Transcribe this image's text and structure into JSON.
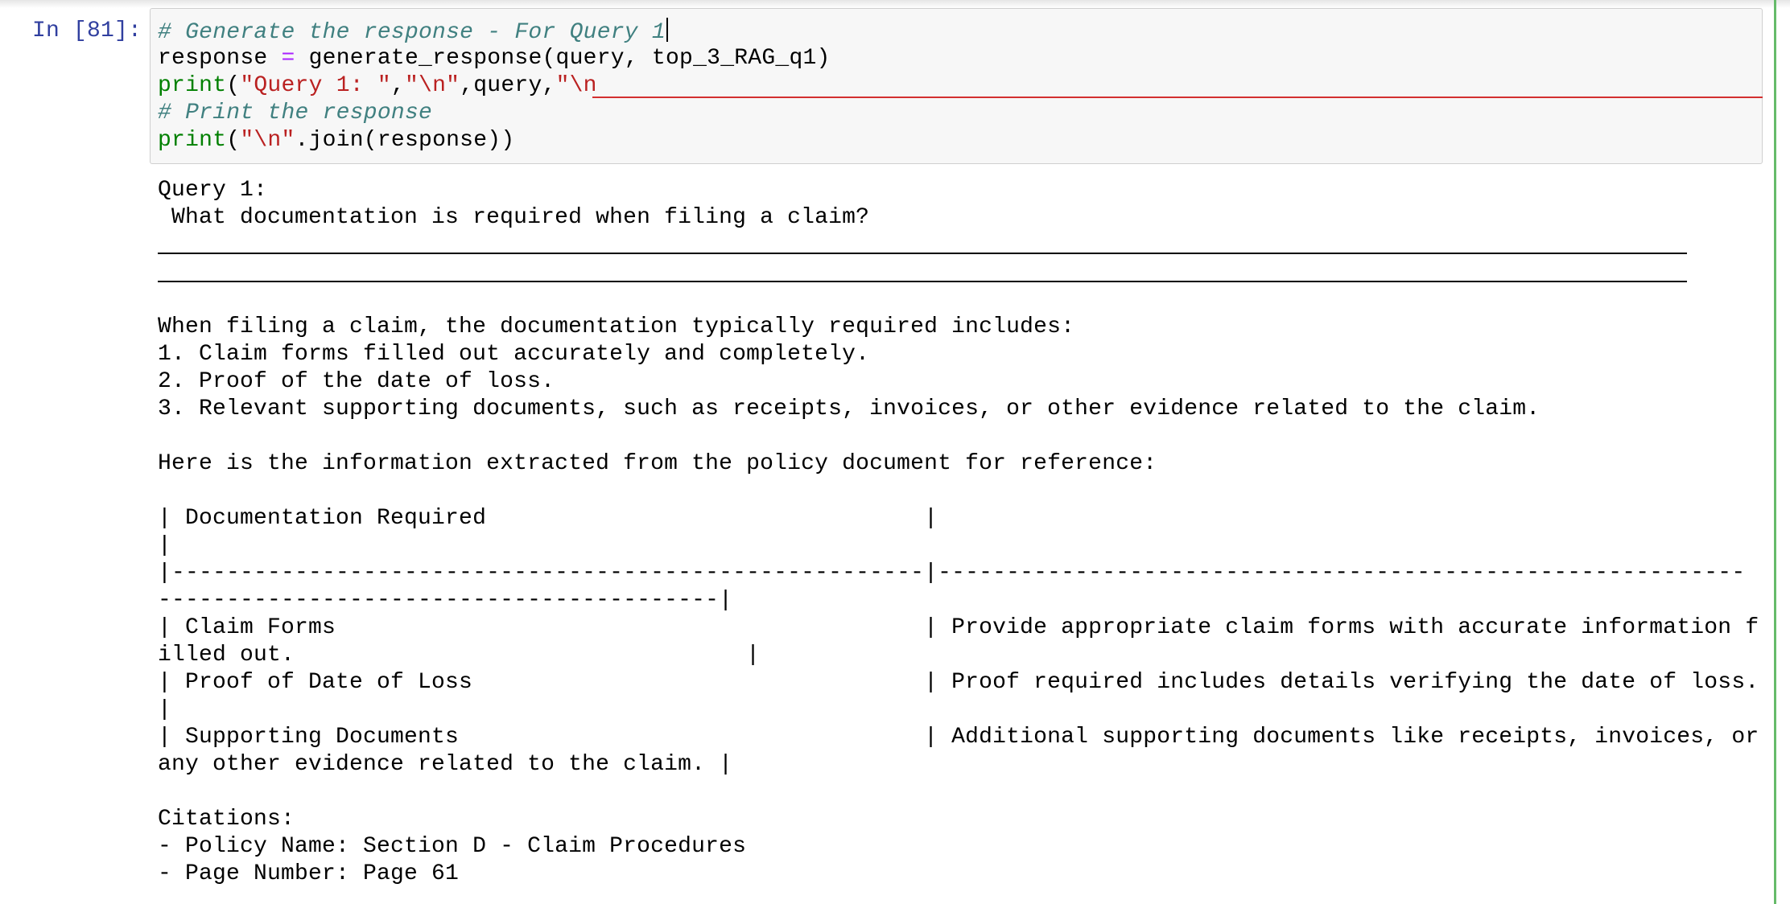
{
  "cell": {
    "prompt": "In [81]:",
    "code": {
      "line1_comment": "# Generate the response - For Query 1",
      "line2": {
        "var": "response",
        "op": "=",
        "rest": "generate_response(query, top_3_RAG_q1)"
      },
      "line3": {
        "kw": "print",
        "p1": "(",
        "s1": "\"Query 1: \"",
        "c1": ",",
        "s2": "\"\\n\"",
        "mid": ",query,",
        "s3": "\"\\n"
      },
      "line4_comment": "# Print the response",
      "line5": {
        "kw": "print",
        "p1": "(",
        "s1": "\"\\n\"",
        "rest": ".join(response))"
      }
    }
  },
  "output": {
    "query_label": "Query 1:",
    "query_text": " What documentation is required when filing a claim?",
    "intro": "When filing a claim, the documentation typically required includes:",
    "items": [
      "1. Claim forms filled out accurately and completely.",
      "2. Proof of the date of loss.",
      "3. Relevant supporting documents, such as receipts, invoices, or other evidence related to the claim."
    ],
    "table_intro": "Here is the information extracted from the policy document for reference:",
    "table_lines": [
      "| Documentation Required                                |",
      "|",
      "|-------------------------------------------------------|-----------------------------------------------------------",
      "-----------------------------------------|",
      "| Claim Forms                                           | Provide appropriate claim forms with accurate information f",
      "illed out.                                 |",
      "| Proof of Date of Loss                                 | Proof required includes details verifying the date of loss.",
      "|",
      "| Supporting Documents                                  | Additional supporting documents like receipts, invoices, or",
      "any other evidence related to the claim. |"
    ],
    "citations_label": "Citations:",
    "citations": [
      "- Policy Name: Section D - Claim Procedures",
      "- Page Number: Page 61"
    ]
  }
}
